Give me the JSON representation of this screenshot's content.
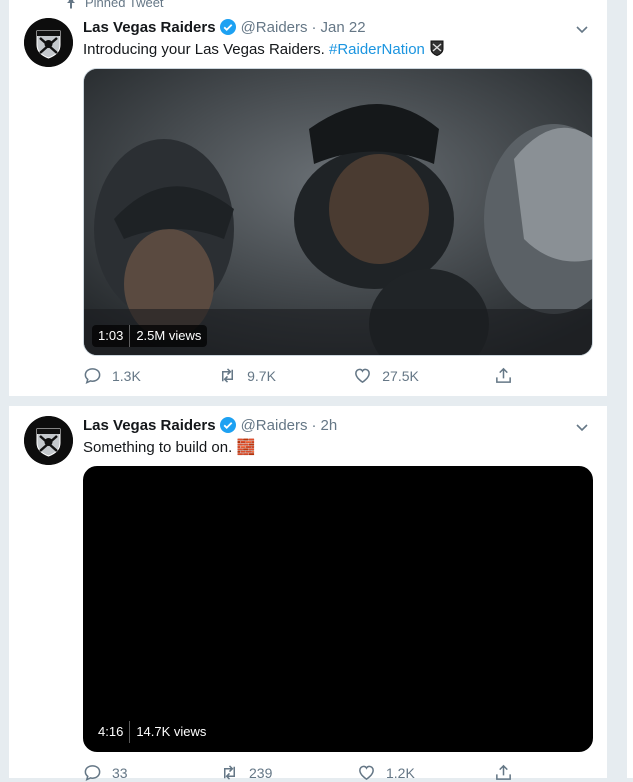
{
  "pinned_label": "Pinned Tweet",
  "tweets": [
    {
      "author_name": "Las Vegas Raiders",
      "handle": "@Raiders",
      "time": "Jan 22",
      "text": "Introducing your Las Vegas Raiders. ",
      "hashtag": "#RaiderNation",
      "video": {
        "duration": "1:03",
        "views": "2.5M views"
      },
      "replies": "1.3K",
      "retweets": "9.7K",
      "likes": "27.5K"
    },
    {
      "author_name": "Las Vegas Raiders",
      "handle": "@Raiders",
      "time": "2h",
      "text": "Something to build on. ",
      "emoji": "🧱",
      "video": {
        "duration": "4:16",
        "views": "14.7K views"
      },
      "replies": "33",
      "retweets": "239",
      "likes": "1.2K"
    }
  ],
  "colors": {
    "accent": "#1b95e0",
    "muted": "#657786",
    "separator": "#e6ecf0"
  },
  "icons": [
    "pin-icon",
    "raiders-shield-icon",
    "verified-badge-icon",
    "chevron-down-icon",
    "reply-icon",
    "retweet-icon",
    "like-icon",
    "share-icon"
  ]
}
